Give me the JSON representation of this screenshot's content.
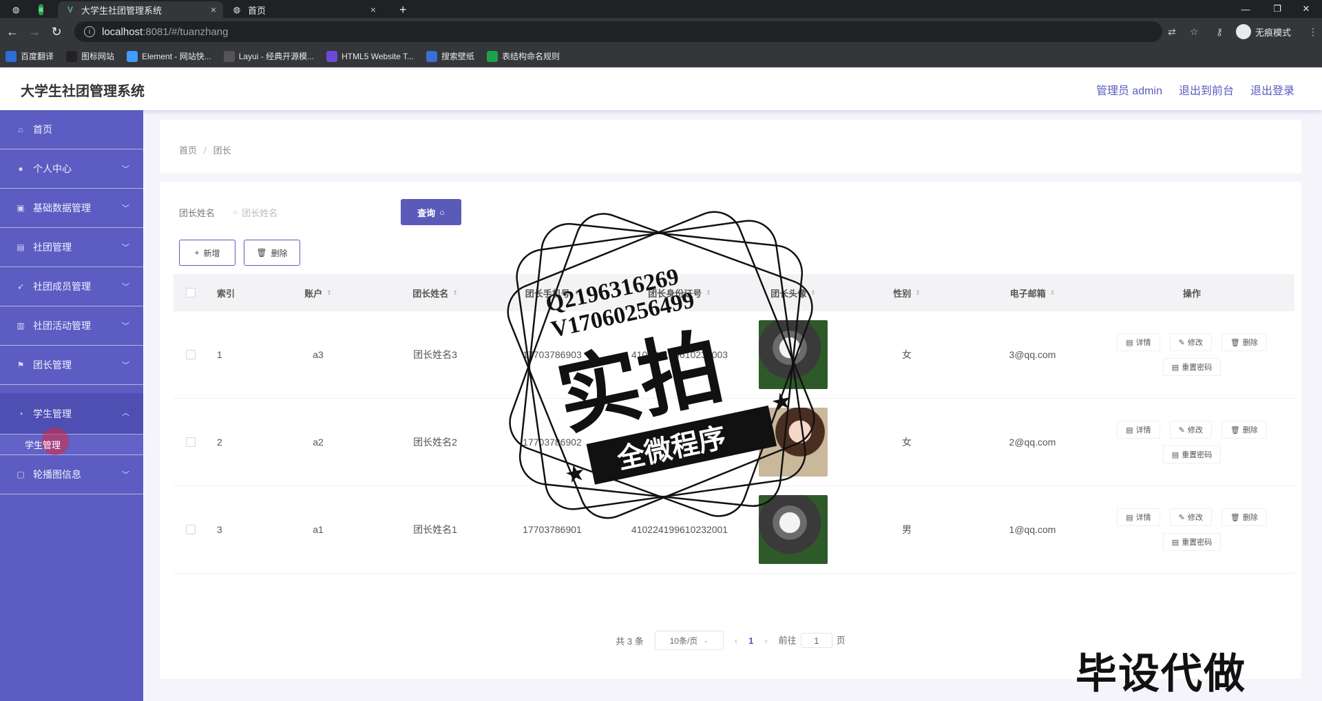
{
  "browser": {
    "tabs": [
      {
        "title": "大学生社团管理系统",
        "close": "×"
      },
      {
        "title": "首页",
        "close": "×"
      }
    ],
    "new_tab": "+",
    "url_host": "localhost",
    "url_rest": ":8081/#/tuanzhang",
    "incognito_label": "无痕模式",
    "bookmarks": [
      {
        "label": "百度翻译",
        "color": "#2b6fd6"
      },
      {
        "label": "图标网站",
        "color": "#222222"
      },
      {
        "label": "Element - 网站快...",
        "color": "#409eff"
      },
      {
        "label": "Layui - 经典开源模...",
        "color": "#555555"
      },
      {
        "label": "HTML5 Website T...",
        "color": "#6b4bd6"
      },
      {
        "label": "搜索壁纸",
        "color": "#3b6fd6"
      },
      {
        "label": "表结构命名规则",
        "color": "#1aa34a"
      }
    ]
  },
  "header": {
    "title": "大学生社团管理系统",
    "links": [
      "管理员 admin",
      "退出到前台",
      "退出登录"
    ]
  },
  "sidebar": {
    "items": [
      {
        "label": "首页",
        "icon": "home-icon",
        "chevron": false
      },
      {
        "label": "个人中心",
        "icon": "user-icon",
        "chevron": true
      },
      {
        "label": "基础数据管理",
        "icon": "data-icon",
        "chevron": true
      },
      {
        "label": "社团管理",
        "icon": "club-icon",
        "chevron": true
      },
      {
        "label": "社团成员管理",
        "icon": "member-icon",
        "chevron": true
      },
      {
        "label": "社团活动管理",
        "icon": "activity-icon",
        "chevron": true
      },
      {
        "label": "团长管理",
        "icon": "flag-icon",
        "chevron": true
      }
    ],
    "open_item": {
      "label": "学生管理",
      "icon": "student-icon",
      "sub": "学生管理"
    },
    "last_item": {
      "label": "轮播图信息",
      "icon": "carousel-icon"
    },
    "accent": "#5c5cc2"
  },
  "breadcrumb": [
    "首页",
    "团长"
  ],
  "search": {
    "label": "团长姓名",
    "placeholder": "团长姓名",
    "button": "查询"
  },
  "actions": {
    "add": "新增",
    "delete": "删除"
  },
  "table": {
    "headers": [
      "索引",
      "账户",
      "团长姓名",
      "团长手机号",
      "团长身份证号",
      "团长头像",
      "性别",
      "电子邮箱",
      "操作"
    ],
    "rows": [
      {
        "index": "1",
        "account": "a3",
        "name": "团长姓名3",
        "phone": "17703786903",
        "idcard": "410224199610232003",
        "avatar": "cat",
        "sex": "女",
        "email": "3@qq.com"
      },
      {
        "index": "2",
        "account": "a2",
        "name": "团长姓名2",
        "phone": "17703786902",
        "idcard": "410224199610232002",
        "avatar": "girl",
        "sex": "女",
        "email": "2@qq.com"
      },
      {
        "index": "3",
        "account": "a1",
        "name": "团长姓名1",
        "phone": "17703786901",
        "idcard": "410224199610232001",
        "avatar": "cat",
        "sex": "男",
        "email": "1@qq.com"
      }
    ],
    "ops": {
      "detail": "详情",
      "edit": "修改",
      "delete": "删除",
      "reset": "重置密码"
    }
  },
  "pager": {
    "total": "共 3 条",
    "size": "10条/页",
    "current": "1",
    "goto": "前往",
    "goto_value": "1",
    "page_unit": "页"
  },
  "watermark": {
    "line1": "Q2196316269",
    "line2": "V17060256499",
    "big": "实拍",
    "banner": "全微程序",
    "bottom": "毕设代做"
  }
}
